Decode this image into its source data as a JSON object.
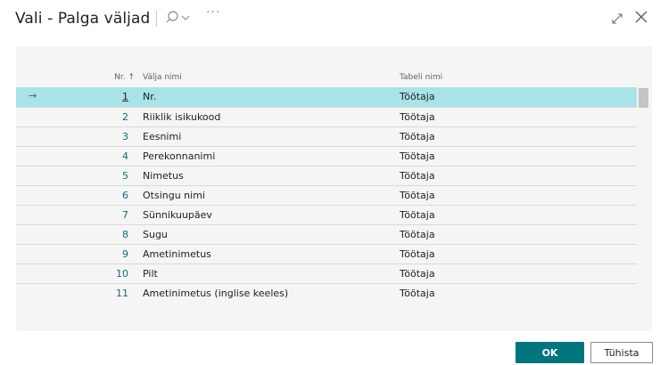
{
  "dialog": {
    "title": "Vali - Palga väljad",
    "more": "···"
  },
  "columns": {
    "nr": "Nr. ↑",
    "field_name": "Välja nimi",
    "table_name": "Tabeli nimi"
  },
  "rows": [
    {
      "nr": "1",
      "name": "Nr.",
      "table": "Töötaja",
      "selected": true
    },
    {
      "nr": "2",
      "name": "Riiklik isikukood",
      "table": "Töötaja"
    },
    {
      "nr": "3",
      "name": "Eesnimi",
      "table": "Töötaja"
    },
    {
      "nr": "4",
      "name": "Perekonnanimi",
      "table": "Töötaja"
    },
    {
      "nr": "5",
      "name": "Nimetus",
      "table": "Töötaja"
    },
    {
      "nr": "6",
      "name": "Otsingu nimi",
      "table": "Töötaja"
    },
    {
      "nr": "7",
      "name": "Sünnikuupäev",
      "table": "Töötaja"
    },
    {
      "nr": "8",
      "name": "Sugu",
      "table": "Töötaja"
    },
    {
      "nr": "9",
      "name": "Ametinimetus",
      "table": "Töötaja"
    },
    {
      "nr": "10",
      "name": "Pilt",
      "table": "Töötaja"
    },
    {
      "nr": "11",
      "name": "Ametinimetus (inglise keeles)",
      "table": "Töötaja"
    }
  ],
  "selected_indicator": "→",
  "buttons": {
    "ok": "OK",
    "cancel": "Tühista"
  },
  "colors": {
    "accent": "#00757d",
    "selected_row": "#a8e3e8"
  },
  "icons": [
    "search-icon",
    "chevron-down-icon",
    "more-icon",
    "expand-icon",
    "close-icon",
    "arrow-right-icon",
    "sort-ascending-icon"
  ]
}
